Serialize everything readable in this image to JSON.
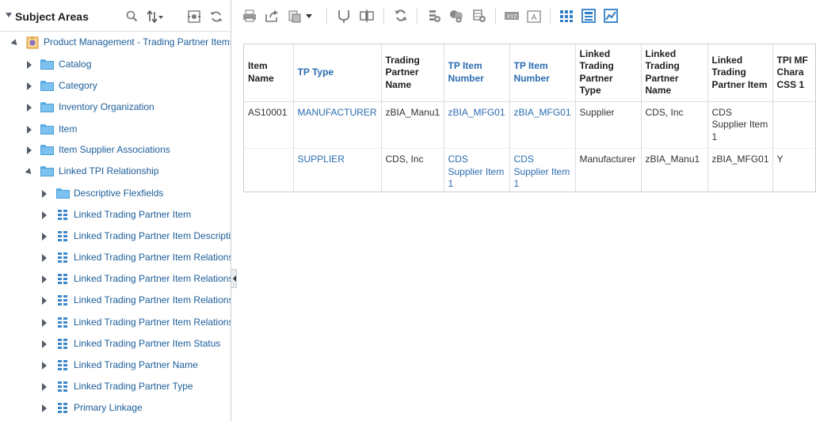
{
  "left_panel": {
    "title": "Subject Areas",
    "tree": [
      {
        "label": "Product Management - Trading Partner Items",
        "level": 0,
        "icon": "subject-area-icon",
        "state": "expanded"
      },
      {
        "label": "Catalog",
        "level": 1,
        "icon": "folder-icon",
        "state": "collapsed"
      },
      {
        "label": "Category",
        "level": 1,
        "icon": "folder-icon",
        "state": "collapsed"
      },
      {
        "label": "Inventory Organization",
        "level": 1,
        "icon": "folder-icon",
        "state": "collapsed"
      },
      {
        "label": "Item",
        "level": 1,
        "icon": "folder-icon",
        "state": "collapsed"
      },
      {
        "label": "Item Supplier Associations",
        "level": 1,
        "icon": "folder-icon",
        "state": "collapsed"
      },
      {
        "label": "Linked TPI Relationship",
        "level": 1,
        "icon": "folder-icon",
        "state": "expanded"
      },
      {
        "label": "Descriptive Flexfields",
        "level": 2,
        "icon": "folder-icon",
        "state": "collapsed"
      },
      {
        "label": "Linked Trading Partner Item",
        "level": 2,
        "icon": "columns-icon",
        "state": "collapsed"
      },
      {
        "label": "Linked Trading Partner Item Description",
        "level": 2,
        "icon": "columns-icon",
        "state": "collapsed"
      },
      {
        "label": "Linked Trading Partner Item Relationship",
        "level": 2,
        "icon": "columns-icon",
        "state": "collapsed"
      },
      {
        "label": "Linked Trading Partner Item Relationship",
        "level": 2,
        "icon": "columns-icon",
        "state": "collapsed"
      },
      {
        "label": "Linked Trading Partner Item Relationship",
        "level": 2,
        "icon": "columns-icon",
        "state": "collapsed"
      },
      {
        "label": "Linked Trading Partner Item Relationship",
        "level": 2,
        "icon": "columns-icon",
        "state": "collapsed"
      },
      {
        "label": "Linked Trading Partner Item Status",
        "level": 2,
        "icon": "columns-icon",
        "state": "collapsed"
      },
      {
        "label": "Linked Trading Partner Name",
        "level": 2,
        "icon": "columns-icon",
        "state": "collapsed"
      },
      {
        "label": "Linked Trading Partner Type",
        "level": 2,
        "icon": "columns-icon",
        "state": "collapsed"
      },
      {
        "label": "Primary Linkage",
        "level": 2,
        "icon": "columns-icon",
        "state": "collapsed"
      }
    ]
  },
  "toolbar": {
    "buttons": [
      "print-icon",
      "export-icon",
      "format-icon",
      "merge-icon",
      "split-icon",
      "refresh-icon",
      "add-row-icon",
      "add-column-icon",
      "add-group-icon",
      "xyz-icon",
      "text-format-icon",
      "table-view-icon",
      "detail-view-icon",
      "graph-view-icon"
    ]
  },
  "table": {
    "headers": [
      {
        "text": "Item Name",
        "link": false
      },
      {
        "text": "TP Type",
        "link": true
      },
      {
        "text": "Trading Partner Name",
        "link": false
      },
      {
        "text": "TP Item Number",
        "link": true
      },
      {
        "text": "TP Item Number",
        "link": true
      },
      {
        "text": "Linked Trading Partner Type",
        "link": false
      },
      {
        "text": "Linked Trading Partner Name",
        "link": false
      },
      {
        "text": "Linked Trading Partner Item",
        "link": false
      },
      {
        "text": "TPI MF Chara CSS 1",
        "link": false
      }
    ],
    "rows": [
      [
        "AS10001",
        "MANUFACTURER",
        "zBIA_Manu1",
        "zBIA_MFG01",
        "zBIA_MFG01",
        "Supplier",
        "CDS, Inc",
        "CDS Supplier Item 1",
        ""
      ],
      [
        "",
        "SUPPLIER",
        "CDS, Inc",
        "CDS Supplier Item 1",
        "CDS Supplier Item 1",
        "Manufacturer",
        "zBIA_Manu1",
        "zBIA_MFG01",
        "Y"
      ]
    ],
    "link_columns": [
      1,
      3,
      4
    ]
  },
  "colors": {
    "link": "#2b6cb0",
    "tree_label": "#1c5d99",
    "folder": "#7cc1ef",
    "grid_icon": "#3b86c9",
    "root_icon": "#e0a93b"
  }
}
